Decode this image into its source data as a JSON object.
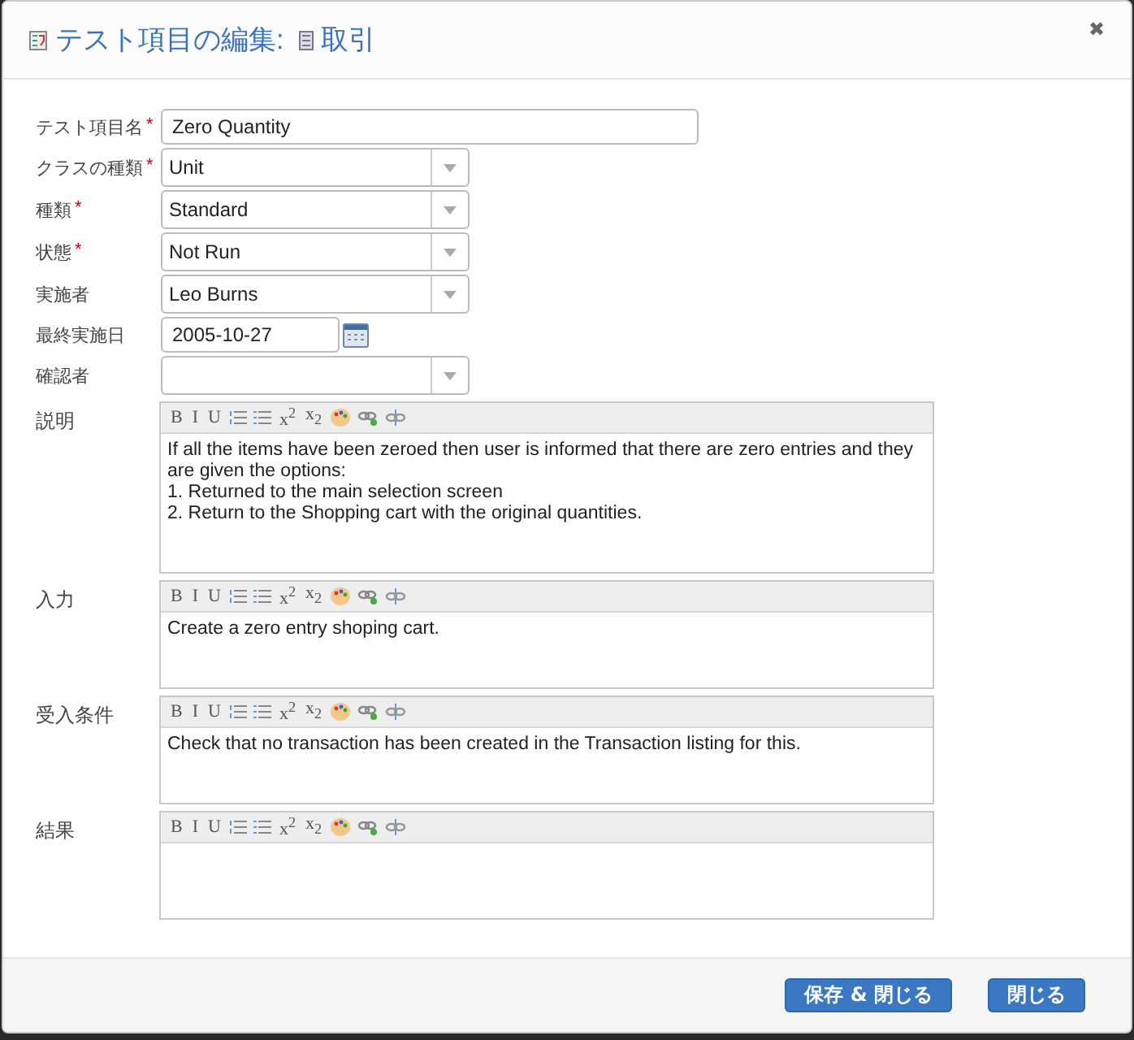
{
  "dialog": {
    "title": "テスト項目の編集:",
    "subtitle": "取引",
    "close": "✖"
  },
  "fields": [
    {
      "kind": "text",
      "label": "テスト項目名",
      "mark": "*",
      "value": "Zero Quantity"
    },
    {
      "kind": "select",
      "label": "クラスの種類",
      "mark": "*",
      "value": "Unit"
    },
    {
      "kind": "select",
      "label": "種類",
      "mark": "*",
      "value": "Standard"
    },
    {
      "kind": "select",
      "label": "状態",
      "mark": "*",
      "value": "Not Run"
    },
    {
      "kind": "select",
      "label": "実施者",
      "value": "Leo Burns"
    },
    {
      "kind": "date",
      "label": "最終実施日",
      "value": "2005-10-27"
    },
    {
      "kind": "select",
      "label": "確認者"
    }
  ],
  "editors": [
    {
      "label": "説明",
      "tools": [
        "B",
        "I",
        "U",
        "x$^{2}$",
        "x$_{2}$"
      ],
      "lines": [
        "If all the items have been zeroed then user is informed that there are zero entries and they are given the options:",
        "1. Returned to the main selection screen",
        "2. Return to the Shopping cart with the original quantities."
      ]
    },
    {
      "label": "入力",
      "tools": [
        "B",
        "I",
        "U",
        "x$^{2}$",
        "x$_{2}$"
      ],
      "lines": [
        "Create a zero entry shoping cart."
      ]
    },
    {
      "label": "受入条件",
      "tools": [
        "B",
        "I",
        "U",
        "x$^{2}$",
        "x$_{2}$"
      ],
      "lines": [
        "Check that no transaction has been created in the Transaction listing for this."
      ]
    },
    {
      "label": "結果",
      "tools": [
        "B",
        "I",
        "U",
        "x$^{2}$",
        "x$_{2}$"
      ]
    }
  ],
  "buttons": [
    "保存 & 閉じる",
    "閉じる"
  ]
}
